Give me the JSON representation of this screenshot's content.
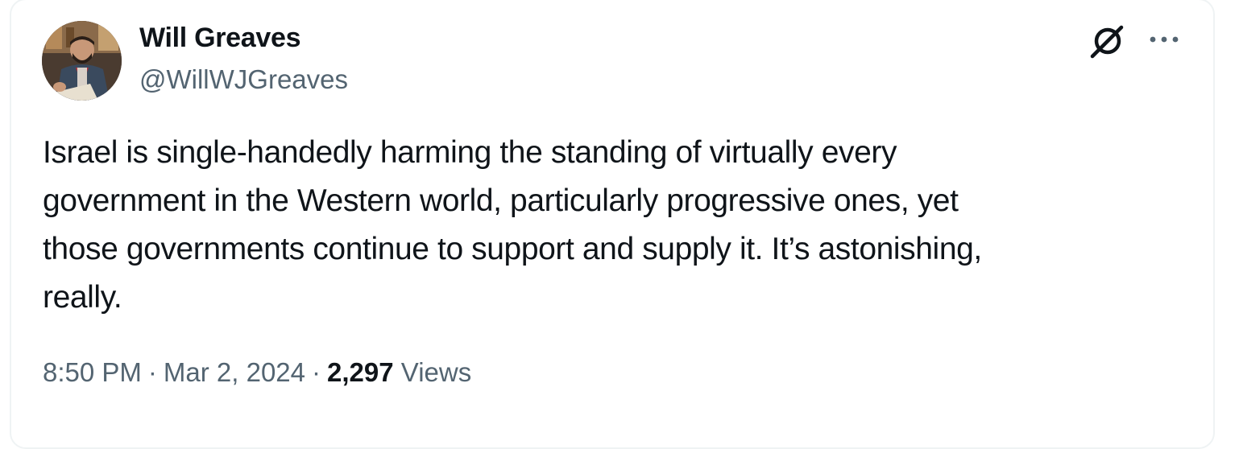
{
  "author": {
    "name": "Will Greaves",
    "handle": "@WillWJGreaves"
  },
  "tweet": {
    "lines": [
      "Israel is single-handedly harming the standing of virtually every",
      "government in the Western world, particularly progressive ones, yet",
      "those governments continue to support and supply it. It’s astonishing,",
      "really."
    ]
  },
  "meta": {
    "time": "8:50 PM",
    "separator": "·",
    "date": "Mar 2, 2024",
    "views_count": "2,297",
    "views_label": "Views"
  },
  "icons": {
    "grok": "grok-icon",
    "more": "more-options-icon"
  },
  "colors": {
    "primary_text": "#0f1419",
    "secondary_text": "#536471",
    "border": "#eff3f4"
  }
}
